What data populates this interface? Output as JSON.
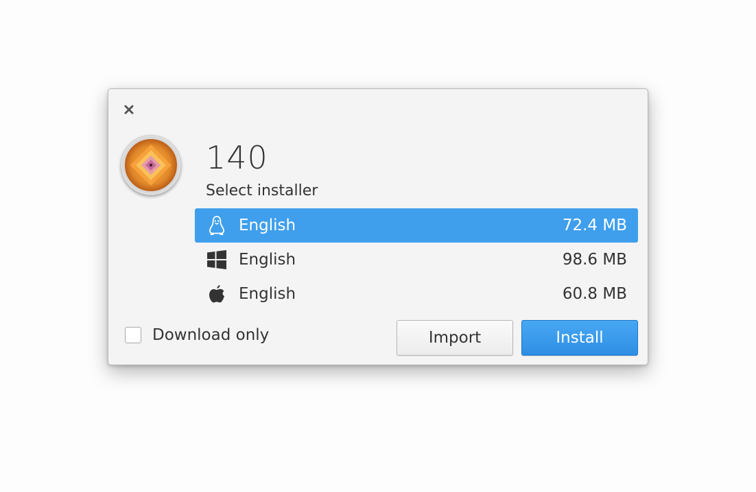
{
  "dialog": {
    "close_icon": "close-icon",
    "game_icon": "game-cover-icon",
    "title": "140",
    "subtitle": "Select installer"
  },
  "installers": [
    {
      "os_icon": "linux-tux-icon",
      "language": "English",
      "size": "72.4 MB",
      "selected": true
    },
    {
      "os_icon": "windows-icon",
      "language": "English",
      "size": "98.6 MB",
      "selected": false
    },
    {
      "os_icon": "apple-icon",
      "language": "English",
      "size": "60.8 MB",
      "selected": false
    }
  ],
  "footer": {
    "download_only_label": "Download only",
    "download_only_checked": false,
    "import_label": "Import",
    "install_label": "Install"
  },
  "colors": {
    "accent": "#3f9fec",
    "dialog_bg": "#f4f4f4",
    "text": "#333333"
  }
}
